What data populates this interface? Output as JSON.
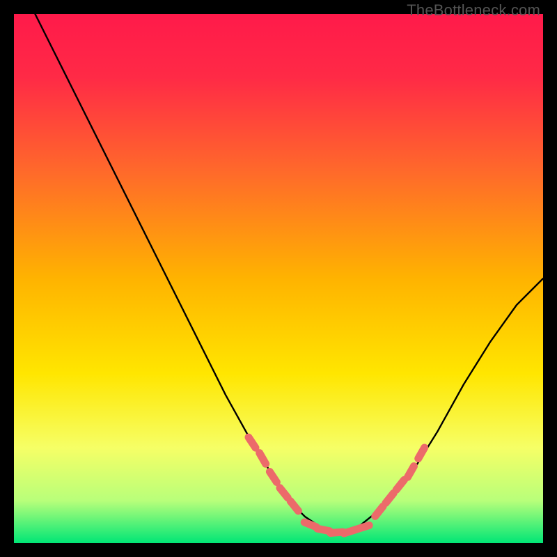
{
  "watermark": "TheBottleneck.com",
  "chart_data": {
    "type": "line",
    "title": "",
    "xlabel": "",
    "ylabel": "",
    "xlim": [
      0,
      100
    ],
    "ylim": [
      0,
      100
    ],
    "background_gradient": {
      "top_color": "#ff1a4a",
      "mid_color": "#ffd200",
      "bottom_color": "#00e676"
    },
    "series": [
      {
        "name": "bottleneck-curve",
        "color": "#000000",
        "x": [
          4,
          10,
          15,
          20,
          25,
          30,
          35,
          40,
          45,
          50,
          53,
          55,
          58,
          60,
          63,
          65,
          70,
          75,
          80,
          85,
          90,
          95,
          100
        ],
        "y": [
          100,
          88,
          78,
          68,
          58,
          48,
          38,
          28,
          19,
          11,
          7,
          5,
          3,
          2,
          2,
          3,
          7,
          13,
          21,
          30,
          38,
          45,
          50
        ]
      }
    ],
    "marker_segments": [
      {
        "name": "left-segment",
        "color": "#ec6a6a",
        "points": [
          {
            "x": 45,
            "y": 19
          },
          {
            "x": 47,
            "y": 16
          },
          {
            "x": 49,
            "y": 12.5
          },
          {
            "x": 51,
            "y": 9.5
          },
          {
            "x": 53,
            "y": 7
          }
        ]
      },
      {
        "name": "bottom-segment",
        "color": "#ec6a6a",
        "points": [
          {
            "x": 56,
            "y": 3.5
          },
          {
            "x": 58.5,
            "y": 2.5
          },
          {
            "x": 61,
            "y": 2
          },
          {
            "x": 63.5,
            "y": 2.2
          },
          {
            "x": 66,
            "y": 3
          }
        ]
      },
      {
        "name": "right-segment",
        "color": "#ec6a6a",
        "points": [
          {
            "x": 69,
            "y": 6
          },
          {
            "x": 71,
            "y": 8.5
          },
          {
            "x": 73,
            "y": 11
          },
          {
            "x": 75,
            "y": 13.5
          },
          {
            "x": 77,
            "y": 17
          }
        ]
      }
    ]
  }
}
